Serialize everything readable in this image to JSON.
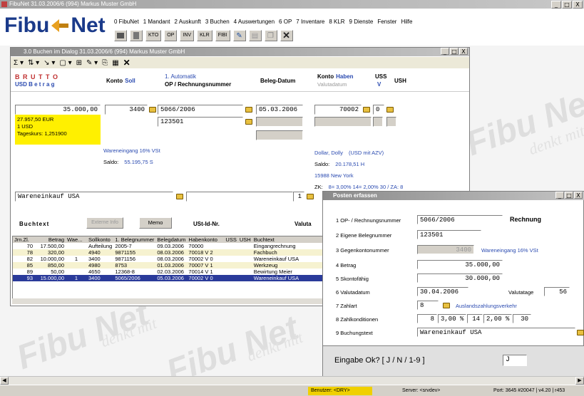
{
  "app": {
    "title": "FibuNet 31.03.2006/6 (994) Markus Muster GmbH",
    "logo_left": "Fibu",
    "logo_right": "Net",
    "watermark": "Fibu Net",
    "watermark_sub": "denkt mit",
    "menu": [
      "0 FibuNet",
      "1 Mandant",
      "2 Auskunft",
      "3 Buchen",
      "4 Auswertungen",
      "6 OP",
      "7 Inventare",
      "8 KLR",
      "9 Dienste",
      "Fenster",
      "Hilfe"
    ],
    "toolbar": [
      "KTO",
      "OP",
      "INV",
      "KLR",
      "FIBI"
    ],
    "window_buttons": [
      "_",
      "□",
      "X"
    ]
  },
  "main_window": {
    "title": "3.0 Buchen im Dialog 31.03.2006/6 (994) Markus Muster GmbH",
    "headers": {
      "brutto": "B R U T T O",
      "usd_betrag": "USD B e t r a g",
      "konto_soll_a": "Konto",
      "konto_soll_b": "Soll",
      "automatik": "1. Automatik",
      "op_nr": "OP / Rechnungsnummer",
      "beleg_datum": "Beleg-Datum",
      "konto_haben_a": "Konto",
      "konto_haben_b": "Haben",
      "valutadatum": "Valutadatum",
      "uss": "USS",
      "uss_v": "V",
      "ush": "USH"
    },
    "betrag": "35.000,00",
    "info": [
      "27.957,50 EUR",
      "1 USD",
      "Tageskurs: 1,251900"
    ],
    "konto_soll": "3400",
    "op_nummer": "5066/2006",
    "beleg_nr": "123501",
    "beleg_datum": "05.03.2006",
    "konto_haben": "70002",
    "uss_val": "0",
    "soll_info": {
      "name": "Wareneingang 16% VSt",
      "saldo_label": "Saldo:",
      "saldo": "55.195,75 S"
    },
    "haben_info": {
      "name": "Dollar, Dolly",
      "note": "(USD mit AZV)",
      "saldo_label": "Saldo:",
      "saldo": "20.178,51 H",
      "city": "15988 New York",
      "zk_label": "ZK:",
      "zk": "8= 3,00% 14= 2,00% 30 / ZA: 8"
    },
    "buchtext": "Wareneinkauf USA",
    "count": "1",
    "row2": {
      "buchtext": "Buchtext",
      "externe_info": "Externe Info",
      "memo": "Memo",
      "ust_id": "USt-Id-Nr.",
      "valuta": "Valuta"
    },
    "table": {
      "headers": [
        "Jrn.Zl.",
        "Betrag",
        "Wae...",
        "Sollkonto",
        "1. Belegnummer",
        "Belegdatum",
        "Habenkonto",
        "USS",
        "USH",
        "Buchtext"
      ],
      "rows": [
        [
          "70",
          "17.500,00",
          "",
          "Aufteilung",
          "2005-7",
          "09.03.2006",
          "70000",
          "",
          "",
          "Eingangrechnung"
        ],
        [
          "78",
          "320,00",
          "",
          "4940",
          "9871155",
          "08.03.2006",
          "70018 V 2",
          "",
          "",
          "Fachbuch"
        ],
        [
          "82",
          "10.000,00",
          "1",
          "3400",
          "9871156",
          "08.03.2006",
          "70002 V 0",
          "",
          "",
          "Wareneinkauf USA"
        ],
        [
          "85",
          "850,00",
          "",
          "4980",
          "8753",
          "01.03.2006",
          "70007 V 1",
          "",
          "",
          "Werkzeug"
        ],
        [
          "89",
          "50,00",
          "",
          "4650",
          "12368-8",
          "02.03.2006",
          "70014 V 1",
          "",
          "",
          "Bewirtung Meier"
        ],
        [
          "93",
          "15.000,00",
          "1",
          "3400",
          "5065/2006",
          "05.03.2006",
          "70002 V 0",
          "",
          "",
          "Wareneinkauf USA"
        ]
      ]
    }
  },
  "posten": {
    "title": "Posten erfassen",
    "labels": [
      "1  OP- / Rechnungsnummer",
      "2  Eigene Belegnummer",
      "3  Gegenkontonummer",
      "4  Betrag",
      "5  Skontofähig",
      "6  Valutadatum",
      "7  Zahlart",
      "8  Zahlkonditionen",
      "9  Buchungstext"
    ],
    "op_nr": "5066/2006",
    "rechnung": "Rechnung",
    "beleg": "123501",
    "gegenkonto": "3400",
    "gegenkonto_name": "Wareneingang 16% VSt",
    "betrag": "35.000,00",
    "skonto": "30.000,00",
    "valuta": "30.04.2006",
    "valutatage_label": "Valutatage",
    "valutatage": "56",
    "zahlart": "8",
    "zahlart_text": "Auslandszahlungsverkehr",
    "konditionen": [
      "8",
      "3,00 %",
      "14",
      "2,00 %",
      "30"
    ],
    "buchungstext": "Wareneinkauf USA",
    "prompt": "Eingabe Ok? [ J / N / 1-9 ]",
    "answer": "J"
  },
  "status": {
    "benutzer": "Benutzer: <DRY>",
    "server": "Server: <srvdev>",
    "port": "Port: 3645  #20047 | v4.20 | r453"
  }
}
